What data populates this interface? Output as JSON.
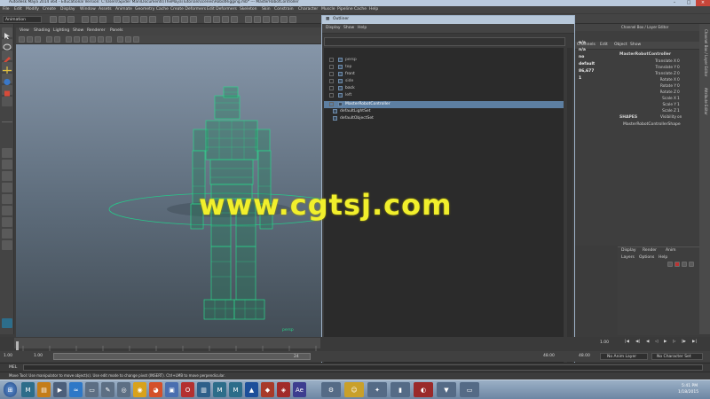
{
  "app": {
    "title": "Autodesk Maya 2014 x64 - Educational Version: C:\\Users\\Spider Man\\Documents\\TheMaya\\Tutorials\\scenes\\RobotRigging.mb* --- MasterRobotController"
  },
  "menubar": [
    "File",
    "Edit",
    "Modify",
    "Create",
    "Display",
    "Window",
    "Assets",
    "Animate",
    "Geometry Cache",
    "Create Deformers",
    "Edit Deformers",
    "Skeleton",
    "Skin",
    "Constrain",
    "Character",
    "Muscle",
    "Pipeline Cache",
    "Help"
  ],
  "status_line": {
    "mode_select": "Animation"
  },
  "viewport": {
    "menu": [
      "View",
      "Shading",
      "Lighting",
      "Show",
      "Renderer",
      "Panels"
    ],
    "camera_label": "persp"
  },
  "outliner": {
    "title": "Outliner",
    "menu": [
      "Display",
      "Show",
      "Help"
    ],
    "items": [
      {
        "label": "persp",
        "dimmed": true,
        "selected": false
      },
      {
        "label": "top",
        "dimmed": true,
        "selected": false
      },
      {
        "label": "front",
        "dimmed": false,
        "selected": false
      },
      {
        "label": "side",
        "dimmed": true,
        "selected": false
      },
      {
        "label": "back",
        "dimmed": false,
        "selected": false
      },
      {
        "label": "left",
        "dimmed": true,
        "selected": false
      },
      {
        "label": "MasterRobotController",
        "dimmed": false,
        "selected": true
      },
      {
        "label": "defaultLightSet",
        "dimmed": false,
        "selected": false
      },
      {
        "label": "defaultObjectSet",
        "dimmed": false,
        "selected": false
      }
    ]
  },
  "channel_box": {
    "header": "Channel Box / Layer Editor",
    "tabs": [
      "Channels",
      "Edit",
      "Object",
      "Show"
    ],
    "object": "MasterRobotController",
    "attributes": [
      {
        "name": "Translate X",
        "value": "0"
      },
      {
        "name": "Translate Y",
        "value": "0"
      },
      {
        "name": "Translate Z",
        "value": "0"
      },
      {
        "name": "Rotate X",
        "value": "0"
      },
      {
        "name": "Rotate Y",
        "value": "0"
      },
      {
        "name": "Rotate Z",
        "value": "0"
      },
      {
        "name": "Scale X",
        "value": "1"
      },
      {
        "name": "Scale Y",
        "value": "1"
      },
      {
        "name": "Scale Z",
        "value": "1"
      },
      {
        "name": "Visibility",
        "value": "on"
      }
    ],
    "shapes_label": "SHAPES",
    "shape_name": "MasterRobotControllerShape",
    "hud_left": [
      "n/a",
      "n/a",
      "no",
      "default",
      "86,677",
      "1"
    ]
  },
  "side_tabs": [
    "Channel Box / Layer Editor",
    "Attribute Editor"
  ],
  "layer_editor": {
    "tabs": [
      "Display",
      "Render",
      "Anim"
    ],
    "menu": [
      "Layers",
      "Options",
      "Help"
    ]
  },
  "timeline": {
    "start": "1.00",
    "current": "1.00",
    "range_start": "1.00",
    "range_end": "24.00",
    "end": "48.00",
    "playback_end": "48.00",
    "tick_label": "24",
    "current_frame_field": "1.00",
    "anim_layer": "No Anim Layer",
    "character_set": "No Character Set"
  },
  "command_line": {
    "label": "MEL"
  },
  "help_line": "Move Tool: Use manipulator to move object(s). Use edit mode to change pivot (INSERT). Ctrl+LMB to move perpendicular.",
  "taskbar": {
    "clock_time": "5:41 PM",
    "clock_date": "1/18/2015"
  },
  "watermark": "www.cgtsj.com",
  "colors": {
    "wire": "#2bd58a",
    "selection": "#5d7fa2",
    "watermark": "#f1ef2c"
  }
}
